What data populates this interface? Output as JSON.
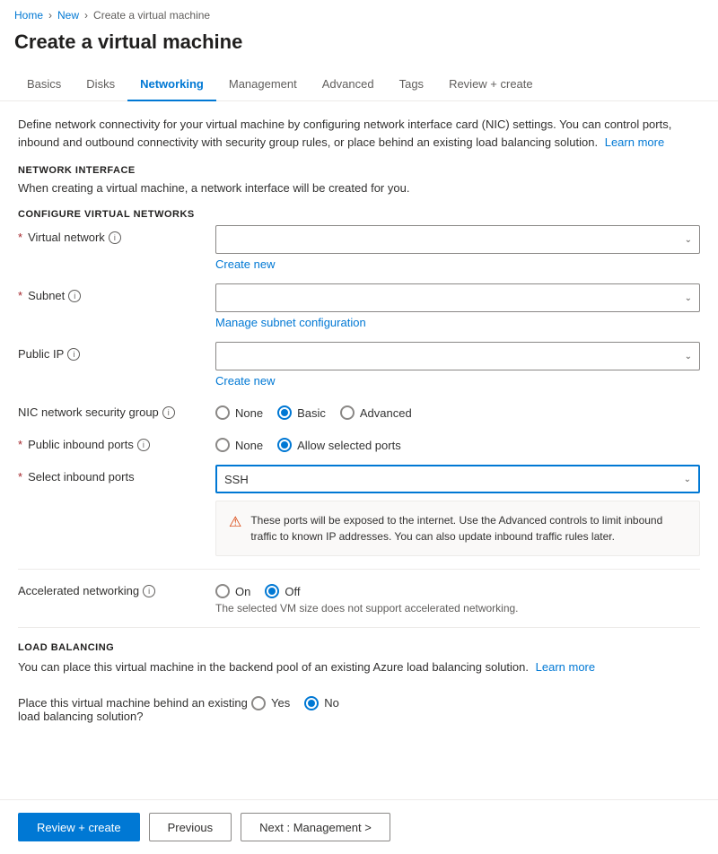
{
  "breadcrumb": {
    "items": [
      "Home",
      "New",
      "Create a virtual machine"
    ]
  },
  "page": {
    "title": "Create a virtual machine"
  },
  "tabs": [
    {
      "id": "basics",
      "label": "Basics",
      "active": false
    },
    {
      "id": "disks",
      "label": "Disks",
      "active": false
    },
    {
      "id": "networking",
      "label": "Networking",
      "active": true
    },
    {
      "id": "management",
      "label": "Management",
      "active": false
    },
    {
      "id": "advanced",
      "label": "Advanced",
      "active": false
    },
    {
      "id": "tags",
      "label": "Tags",
      "active": false
    },
    {
      "id": "review",
      "label": "Review + create",
      "active": false
    }
  ],
  "description": {
    "text": "Define network connectivity for your virtual machine by configuring network interface card (NIC) settings. You can control ports, inbound and outbound connectivity with security group rules, or place behind an existing load balancing solution.",
    "learn_more": "Learn more"
  },
  "network_interface": {
    "section_title": "NETWORK INTERFACE",
    "section_desc": "When creating a virtual machine, a network interface will be created for you.",
    "configure_title": "CONFIGURE VIRTUAL NETWORKS",
    "virtual_network": {
      "label": "Virtual network",
      "value": "",
      "create_new": "Create new"
    },
    "subnet": {
      "label": "Subnet",
      "value": "",
      "manage_link": "Manage subnet configuration"
    },
    "public_ip": {
      "label": "Public IP",
      "value": "",
      "create_new": "Create new"
    },
    "nic_security_group": {
      "label": "NIC network security group",
      "options": [
        "None",
        "Basic",
        "Advanced"
      ],
      "selected": "Basic"
    },
    "public_inbound_ports": {
      "label": "Public inbound ports",
      "options": [
        "None",
        "Allow selected ports"
      ],
      "selected": "Allow selected ports"
    },
    "select_inbound_ports": {
      "label": "Select inbound ports",
      "value": "SSH"
    },
    "warning": {
      "text": "These ports will be exposed to the internet. Use the Advanced controls to limit inbound traffic to known IP addresses. You can also update inbound traffic rules later."
    }
  },
  "accelerated_networking": {
    "label": "Accelerated networking",
    "options": [
      "On",
      "Off"
    ],
    "selected": "Off",
    "note": "The selected VM size does not support accelerated networking."
  },
  "load_balancing": {
    "section_title": "LOAD BALANCING",
    "description": "You can place this virtual machine in the backend pool of an existing Azure load balancing solution.",
    "learn_more": "Learn more",
    "place_behind": {
      "label": "Place this virtual machine behind an existing load balancing solution?",
      "options": [
        "Yes",
        "No"
      ],
      "selected": "No"
    }
  },
  "footer": {
    "review_create": "Review + create",
    "previous": "Previous",
    "next": "Next : Management >"
  }
}
